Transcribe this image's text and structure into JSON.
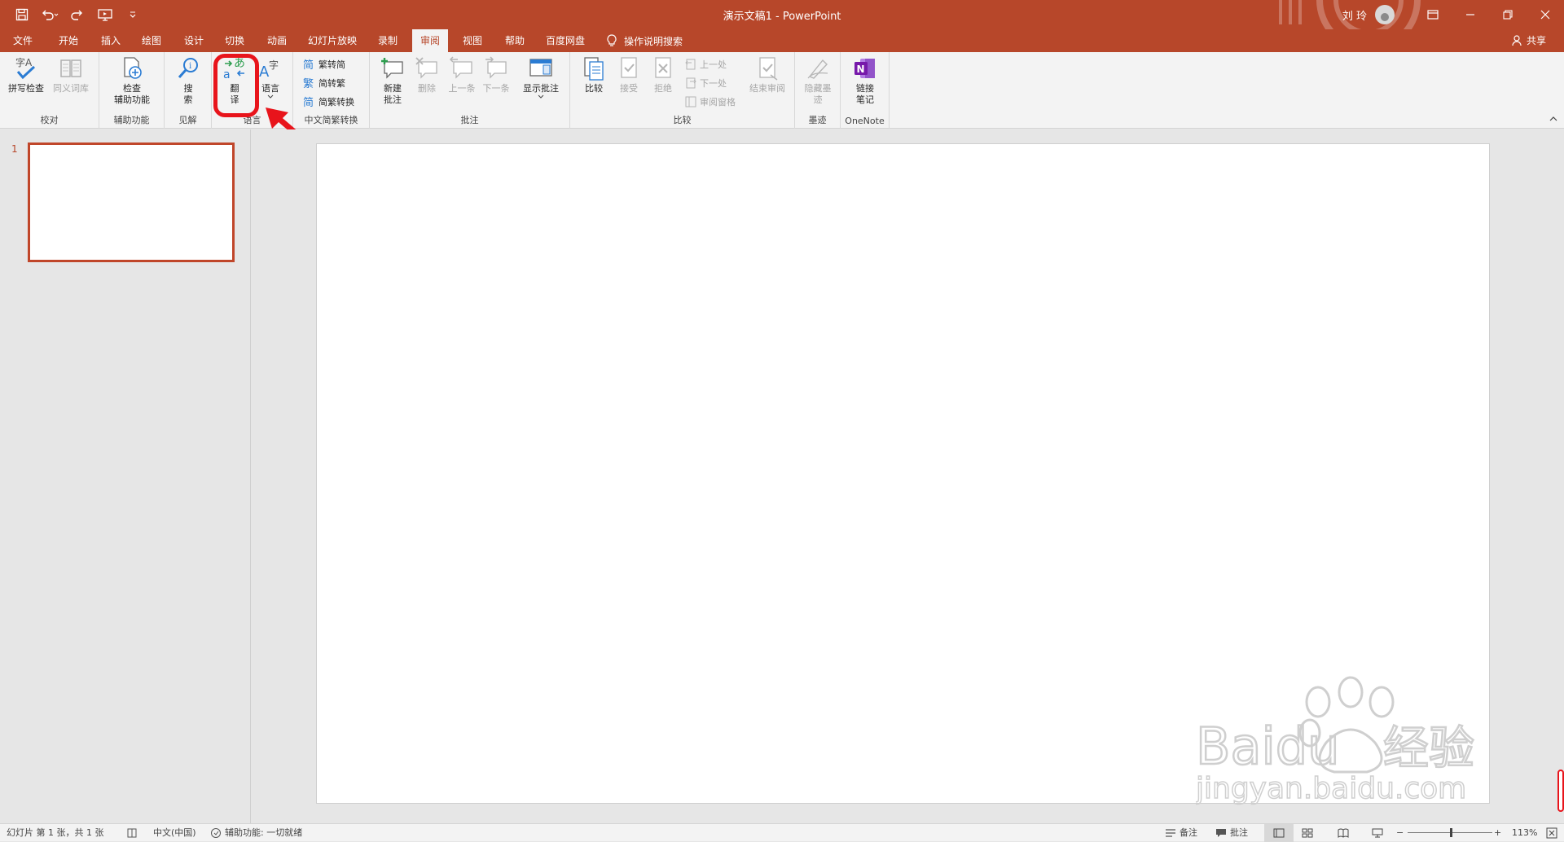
{
  "titlebar": {
    "title": "演示文稿1  -  PowerPoint",
    "user": "刘 玲"
  },
  "tabs": [
    {
      "label": "文件"
    },
    {
      "label": "开始"
    },
    {
      "label": "插入"
    },
    {
      "label": "绘图"
    },
    {
      "label": "设计"
    },
    {
      "label": "切换"
    },
    {
      "label": "动画"
    },
    {
      "label": "幻灯片放映"
    },
    {
      "label": "录制"
    },
    {
      "label": "审阅"
    },
    {
      "label": "视图"
    },
    {
      "label": "帮助"
    },
    {
      "label": "百度网盘"
    }
  ],
  "tell_me": "操作说明搜索",
  "share": "共享",
  "ribbon": {
    "proofing": {
      "label": "校对",
      "spell": "拼写检查",
      "thesaurus": "同义词库"
    },
    "accessibility": {
      "label": "辅助功能",
      "check_line1": "检查",
      "check_line2": "辅助功能"
    },
    "insights": {
      "label": "见解",
      "search_line1": "搜",
      "search_line2": "索"
    },
    "language": {
      "label": "语言",
      "translate_line1": "翻",
      "translate_line2": "译",
      "language": "语言"
    },
    "chinese": {
      "label": "中文简繁转换",
      "t2s": "繁转简",
      "s2t": "简转繁",
      "convert": "简繁转换"
    },
    "comments": {
      "label": "批注",
      "new_line1": "新建",
      "new_line2": "批注",
      "delete": "删除",
      "prev": "上一条",
      "next": "下一条",
      "show": "显示批注"
    },
    "compare": {
      "label": "比较",
      "compare": "比较",
      "accept": "接受",
      "reject": "拒绝",
      "prev": "上一处",
      "next": "下一处",
      "pane": "审阅窗格",
      "end": "结束审阅"
    },
    "ink": {
      "label": "墨迹",
      "hide_line1": "隐藏墨",
      "hide_line2": "迹"
    },
    "onenote": {
      "label": "OneNote",
      "link_line1": "链接",
      "link_line2": "笔记"
    }
  },
  "thumbnails": {
    "slide_number": "1"
  },
  "statusbar": {
    "slide_info": "幻灯片 第 1 张，共 1 张",
    "language": "中文(中国)",
    "accessibility": "辅助功能: 一切就绪",
    "notes": "备注",
    "comments": "批注",
    "zoom": "113%"
  },
  "watermark": {
    "brand": "Baidu",
    "product": "经验",
    "url": "jingyan.baidu.com"
  },
  "colors": {
    "accent": "#b7472a",
    "highlight": "#e8141b"
  }
}
